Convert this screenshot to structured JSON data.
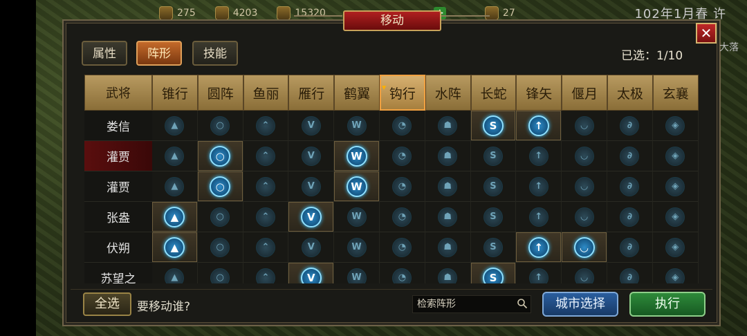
{
  "topbar": {
    "resources": [
      {
        "icon": "resource-icon",
        "value": "275"
      },
      {
        "icon": "resource-icon",
        "value": "4203"
      },
      {
        "icon": "resource-icon",
        "value": "15320"
      },
      {
        "icon": "resource-icon",
        "value": "27"
      }
    ],
    "add_symbol": "+",
    "date": "102年1月春 许"
  },
  "dialog": {
    "title": "移动",
    "close_symbol": "✕",
    "tabs": [
      "属性",
      "阵形",
      "技能"
    ],
    "active_tab": 1,
    "selected_label": "已选：",
    "selected_count": "1/10"
  },
  "table": {
    "general_header": "武将",
    "formations": [
      "锥行",
      "圆阵",
      "鱼丽",
      "雁行",
      "鹤翼",
      "钩行",
      "水阵",
      "长蛇",
      "锋矢",
      "偃月",
      "太极",
      "玄襄"
    ],
    "active_formation": 5,
    "formation_glyphs": [
      "▲",
      "○",
      "⌃",
      "V",
      "W",
      "◔",
      "☗",
      "S",
      "↑",
      "◡",
      "∂",
      "◈"
    ],
    "rows": [
      {
        "name": "娄信",
        "selected": false,
        "on": [
          7,
          8
        ]
      },
      {
        "name": "灌贾",
        "selected": true,
        "on": [
          1,
          4
        ]
      },
      {
        "name": "灌贾",
        "selected": false,
        "on": [
          1,
          4
        ]
      },
      {
        "name": "张盎",
        "selected": false,
        "on": [
          0,
          3
        ]
      },
      {
        "name": "伏朔",
        "selected": false,
        "on": [
          0,
          8,
          9
        ]
      },
      {
        "name": "苏望之",
        "selected": false,
        "on": [
          3,
          7
        ]
      }
    ]
  },
  "footer": {
    "select_all": "全选",
    "prompt": "要移动谁?",
    "search_placeholder": "检索阵形",
    "city_select": "城市选择",
    "execute": "执行"
  },
  "side": {
    "right_text": "大落"
  },
  "colors": {
    "accent_red": "#a81818",
    "gold": "#c8a25a",
    "lit_icon": "#2e8cc8"
  }
}
